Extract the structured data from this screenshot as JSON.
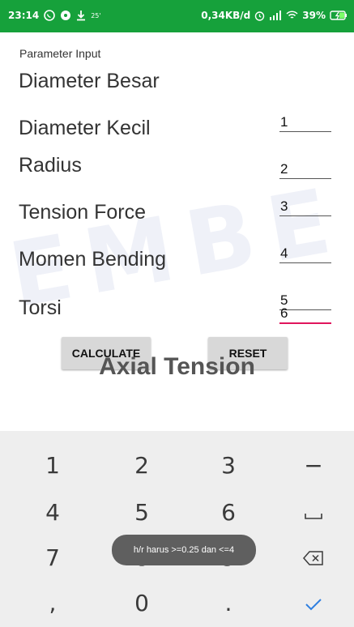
{
  "status_bar": {
    "time": "23:14",
    "notif_small": "25'",
    "speed": "0,34KB/d",
    "battery": "39%"
  },
  "watermark": {
    "text": "EMBE"
  },
  "form": {
    "section_label": "Parameter Input",
    "rows": [
      {
        "label": "Diameter Besar",
        "value": "1"
      },
      {
        "label": "Diameter Kecil",
        "value": "2"
      },
      {
        "label": "Radius",
        "value": "3"
      },
      {
        "label": "Tension Force",
        "value": "4"
      },
      {
        "label": "Momen Bending",
        "value": "5"
      },
      {
        "label": "Torsi",
        "value": "6"
      }
    ],
    "calculate_label": "CALCULATE",
    "reset_label": "RESET",
    "result_title": "Axial Tension"
  },
  "keyboard": {
    "keys": [
      "1",
      "2",
      "3",
      "−",
      "4",
      "5",
      "6",
      "",
      "7",
      "8",
      "9",
      "",
      ",",
      "0",
      ".",
      ""
    ],
    "icons": {
      "space": "space-key-icon",
      "backspace": "backspace-icon",
      "done": "done-check-icon"
    }
  },
  "toast": {
    "text": "h/r harus >=0.25 dan <=4"
  },
  "colors": {
    "status_bar": "#16a13b",
    "accent": "#e0155c",
    "keyboard_bg": "#eeeeee"
  }
}
